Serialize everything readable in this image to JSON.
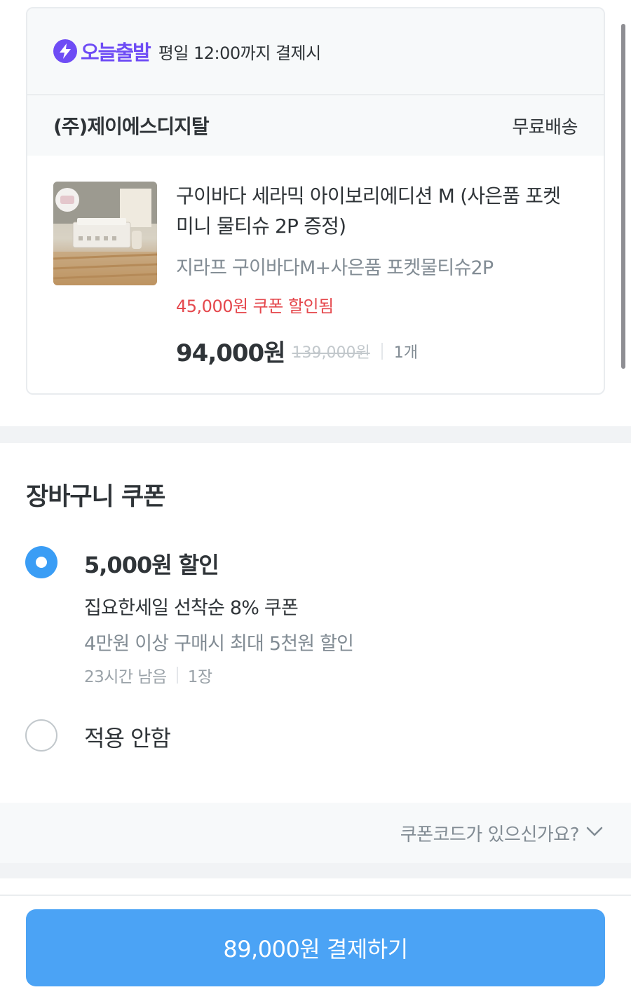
{
  "delivery": {
    "badge_label": "오늘출발",
    "badge_icon": "lightning-icon",
    "cutoff_text": "평일 12:00까지 결제시"
  },
  "seller": {
    "name": "(주)제이에스디지탈",
    "shipping": "무료배송"
  },
  "product": {
    "name": "구이바다 세라믹 아이보리에디션 M (사은품 포켓 미니 물티슈 2P 증정)",
    "option": "지라프 구이바다M+사은품 포켓물티슈2P",
    "coupon_discount": "45,000원 쿠폰 할인됨",
    "price": "94,000원",
    "original_price": "139,000원",
    "quantity": "1개"
  },
  "coupons": {
    "title": "장바구니 쿠폰",
    "options": [
      {
        "selected": true,
        "amount": "5,000원 할인",
        "name": "집요한세일 선착순 8% 쿠폰",
        "condition": "4만원 이상 구매시 최대 5천원 할인",
        "time_left": "23시간 남음",
        "count": "1장"
      },
      {
        "selected": false,
        "label": "적용 안함"
      }
    ],
    "code_prompt": "쿠폰코드가 있으신가요?"
  },
  "checkout": {
    "button_label": "89,000원 결제하기"
  },
  "colors": {
    "brand_purple": "#6e4cf5",
    "accent_blue": "#3a9df5",
    "pay_button": "#4ba3f5",
    "discount_red": "#e5484d"
  }
}
